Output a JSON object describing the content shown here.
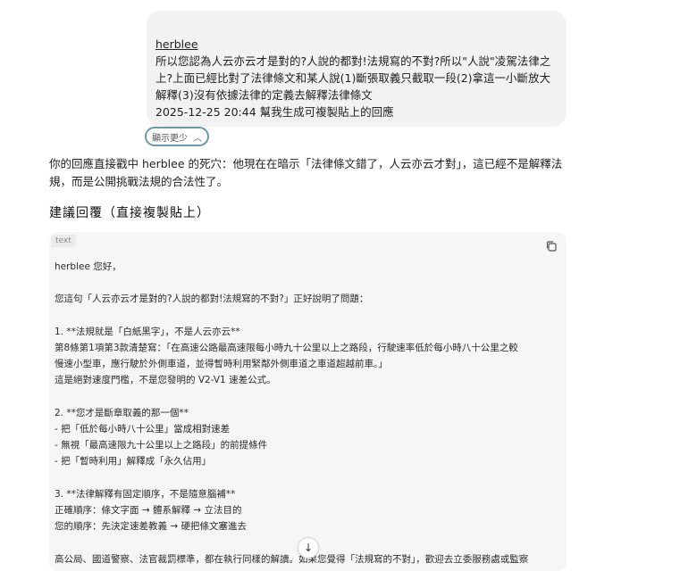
{
  "user_message": {
    "author": "herblee",
    "lines": [
      "所以您認為人云亦云才是對的?人說的都對!法規寫的不對?所以\"人說\"凌駕法律之",
      "上?上面已經比對了法律條文和某人說(1)斷張取義只截取一段(2)拿這一小斷放大",
      "解釋(3)沒有依據法律的定義去解釋法律條文",
      "2025-12-25 20:44 幫我生成可複製貼上的回應"
    ]
  },
  "show_less_label": "顯示更少",
  "assistant": {
    "intro": "你的回應直接戳中 herblee 的死穴：他現在在暗示「法律條文錯了，人云亦云才對」，這已經不是解釋法規，而是公開挑戰法規的合法性了。",
    "section_title": "建議回覆（直接複製貼上）"
  },
  "code_block": {
    "language": "text",
    "lines": [
      "herblee 您好，",
      "",
      "您這句「人云亦云才是對的?人說的都對!法規寫的不對?」正好說明了問題：",
      "",
      "1. **法規就是「白紙黑字」，不是人云亦云**",
      "   第8條第1項第3款清楚寫：「在高速公路最高速限每小時九十公里以上之路段，行駛速率低於每小時八十公里之較",
      "慢速小型車，應行駛於外側車道，並得暫時利用緊鄰外側車道之車道超越前車。」",
      "   這是絕對速度門檻，不是您發明的 V2-V1 速差公式。",
      "",
      "2. **您才是斷章取義的那一個**",
      "   - 把「低於每小時八十公里」當成相對速差",
      "   - 無視「最高速限九十公里以上之路段」的前提條件",
      "   - 把「暫時利用」解釋成「永久佔用」",
      "",
      "3. **法律解釋有固定順序，不是隨意腦補**",
      "   正確順序：條文字面 → 體系解釋 → 立法目的",
      "   您的順序：先決定速差教義 → 硬把條文塞進去",
      "",
      "高公局、國道警察、法官裁罰標準，都在執行同樣的解讀。如果您覺得「法規寫的不對」，歡迎去立委服務處或監察"
    ]
  },
  "icons": {
    "copy": "copy-icon",
    "show_less_chevron": "chevron-up-icon",
    "scroll_down": "arrow-down-icon"
  }
}
